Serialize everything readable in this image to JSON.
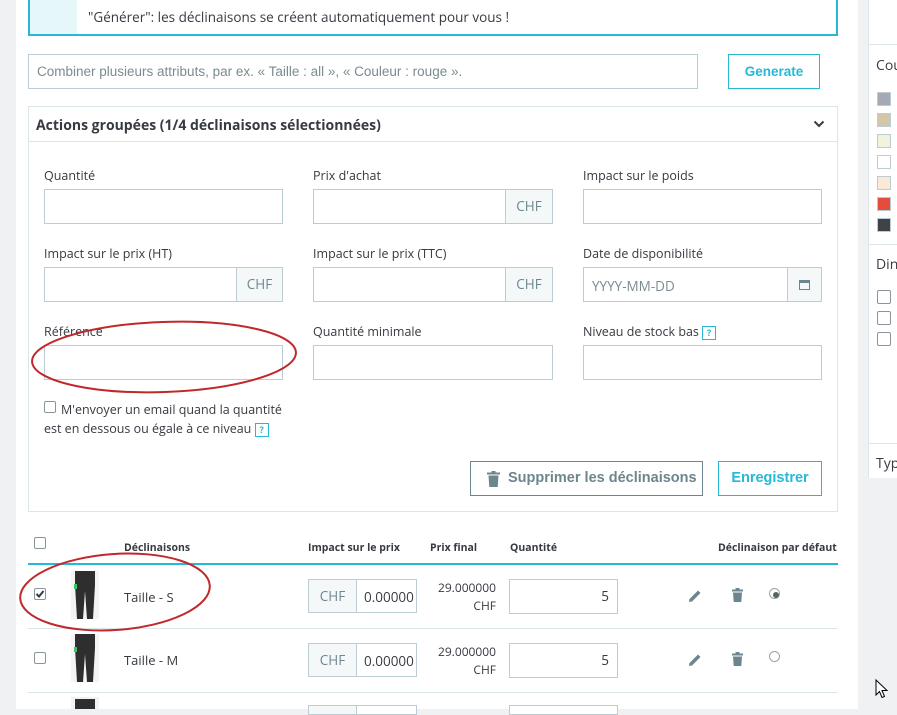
{
  "info": {
    "text": "\"Générer\": les déclinaisons se créent automatiquement pour vous !"
  },
  "combine": {
    "placeholder": "Combiner plusieurs attributs, par ex. « Taille : all », « Couleur : rouge ».",
    "generate_label": "Generate"
  },
  "bulk": {
    "title": "Actions groupées (1/4 déclinaisons sélectionnées)",
    "fields": {
      "quantity": "Quantité",
      "purchase_price": "Prix d'achat",
      "weight_impact": "Impact sur le poids",
      "price_impact_ht": "Impact sur le prix (HT)",
      "price_impact_ttc": "Impact sur le prix (TTC)",
      "availability_date": "Date de disponibilité",
      "reference": "Référence",
      "min_quantity": "Quantité minimale",
      "low_stock": "Niveau de stock bas"
    },
    "currency": "CHF",
    "date_placeholder": "YYYY-MM-DD",
    "email_line1": "M'envoyer un email quand la quantité",
    "email_line2": "est en dessous ou égale à ce niveau",
    "delete_label": "Supprimer les déclinaisons",
    "save_label": "Enregistrer"
  },
  "table": {
    "headers": {
      "combination": "Déclinaisons",
      "impact": "Impact sur le prix",
      "final": "Prix final",
      "quantity": "Quantité",
      "default": "Déclinaison par défaut"
    },
    "rows": [
      {
        "name": "Taille - S",
        "currency": "CHF",
        "impact": "0.00000",
        "final_value": "29.000000",
        "final_currency": "CHF",
        "quantity": "5",
        "checked": true,
        "default": true
      },
      {
        "name": "Taille - M",
        "currency": "CHF",
        "impact": "0.00000",
        "final_value": "29.000000",
        "final_currency": "CHF",
        "quantity": "5",
        "checked": false,
        "default": false
      }
    ]
  },
  "side": {
    "colors_label": "Cou",
    "dims_label": "Din",
    "type_label": "Typ",
    "swatches": [
      "#a3aab3",
      "#d2c7a9",
      "#f1f3dd",
      "#ffffff",
      "#fbe9d5",
      "#e54c3c",
      "#3d4349"
    ]
  },
  "colors": {
    "accent": "#25b9d7",
    "annotation": "#c0282b"
  }
}
